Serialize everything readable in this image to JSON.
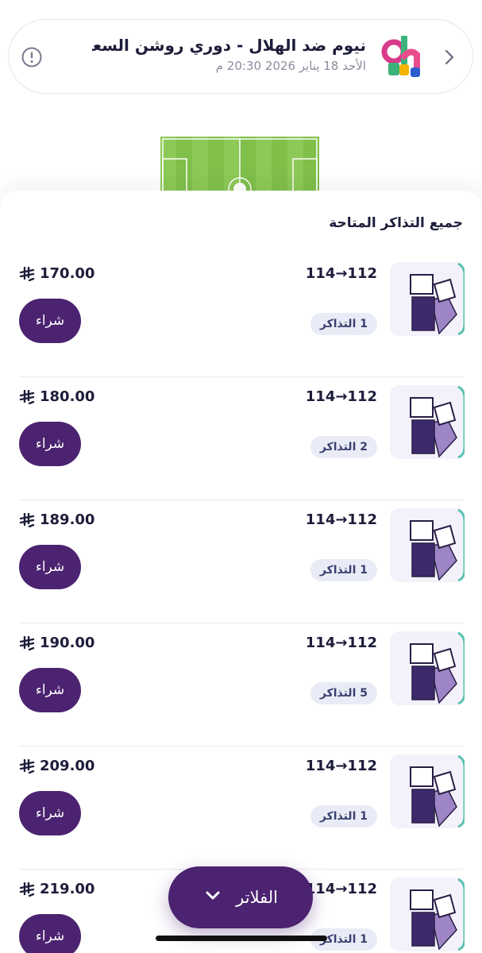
{
  "event": {
    "title": "نيوم ضد الهلال - دوري روشن السعودي ...",
    "date": "الأحد 18 يناير 2026 20:30 م"
  },
  "list": {
    "title": "جميع التذاكر المتاحة",
    "buy_label": "شراء",
    "rows": [
      {
        "route": "114→112",
        "count": "1 التذاكر",
        "price": "170.00"
      },
      {
        "route": "114→112",
        "count": "2 التذاكر",
        "price": "180.00"
      },
      {
        "route": "114→112",
        "count": "1 التذاكر",
        "price": "189.00"
      },
      {
        "route": "114→112",
        "count": "5 التذاكر",
        "price": "190.00"
      },
      {
        "route": "114→112",
        "count": "1 التذاكر",
        "price": "209.00"
      },
      {
        "route": "114→112",
        "count": "1 التذاكر",
        "price": "219.00"
      }
    ]
  },
  "filter": {
    "label": "الفلاتر"
  },
  "colors": {
    "brand": "#4b2370",
    "accent": "#5cc1b2",
    "text": "#1d1d3a"
  },
  "icons": [
    "info-icon",
    "chevron-right-icon",
    "logo",
    "pitch-map",
    "ticket-thumbnail-icon",
    "riyal-icon",
    "chevron-down-icon"
  ]
}
